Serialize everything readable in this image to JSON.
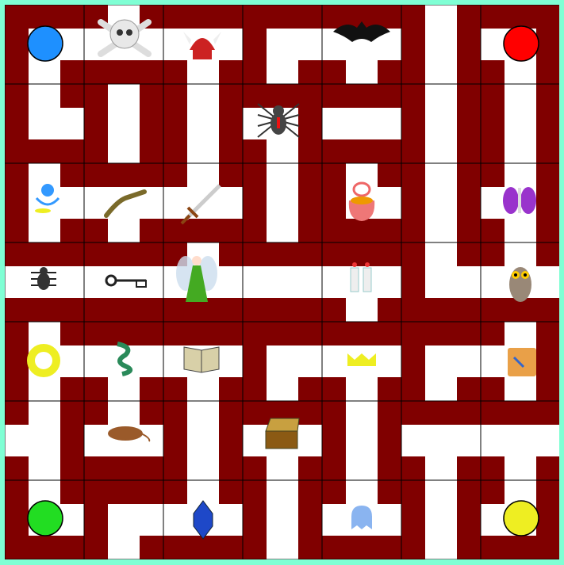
{
  "board": {
    "rows": 7,
    "cols": 7,
    "colors": {
      "background": "#7fffd4",
      "wall": "#800000",
      "path": "#ffffff",
      "grid": "#000000"
    }
  },
  "players": [
    {
      "id": "blue",
      "color": "#1e90ff"
    },
    {
      "id": "red",
      "color": "#ff0000"
    },
    {
      "id": "green",
      "color": "#22dd22"
    },
    {
      "id": "yellow",
      "color": "#eeee22"
    }
  ],
  "treasures": [
    "skull-icon",
    "helmet-icon",
    "bat-icon",
    "spider-icon",
    "genie-icon",
    "lizard-icon",
    "sword-icon",
    "bag-icon",
    "moth-icon",
    "beetle-icon",
    "key-icon",
    "fairy-icon",
    "candles-icon",
    "owl-icon",
    "ring-icon",
    "dragon-icon",
    "book-icon",
    "crown-icon",
    "map-icon",
    "rat-icon",
    "chest-icon",
    "gem-icon",
    "ghost-icon"
  ]
}
